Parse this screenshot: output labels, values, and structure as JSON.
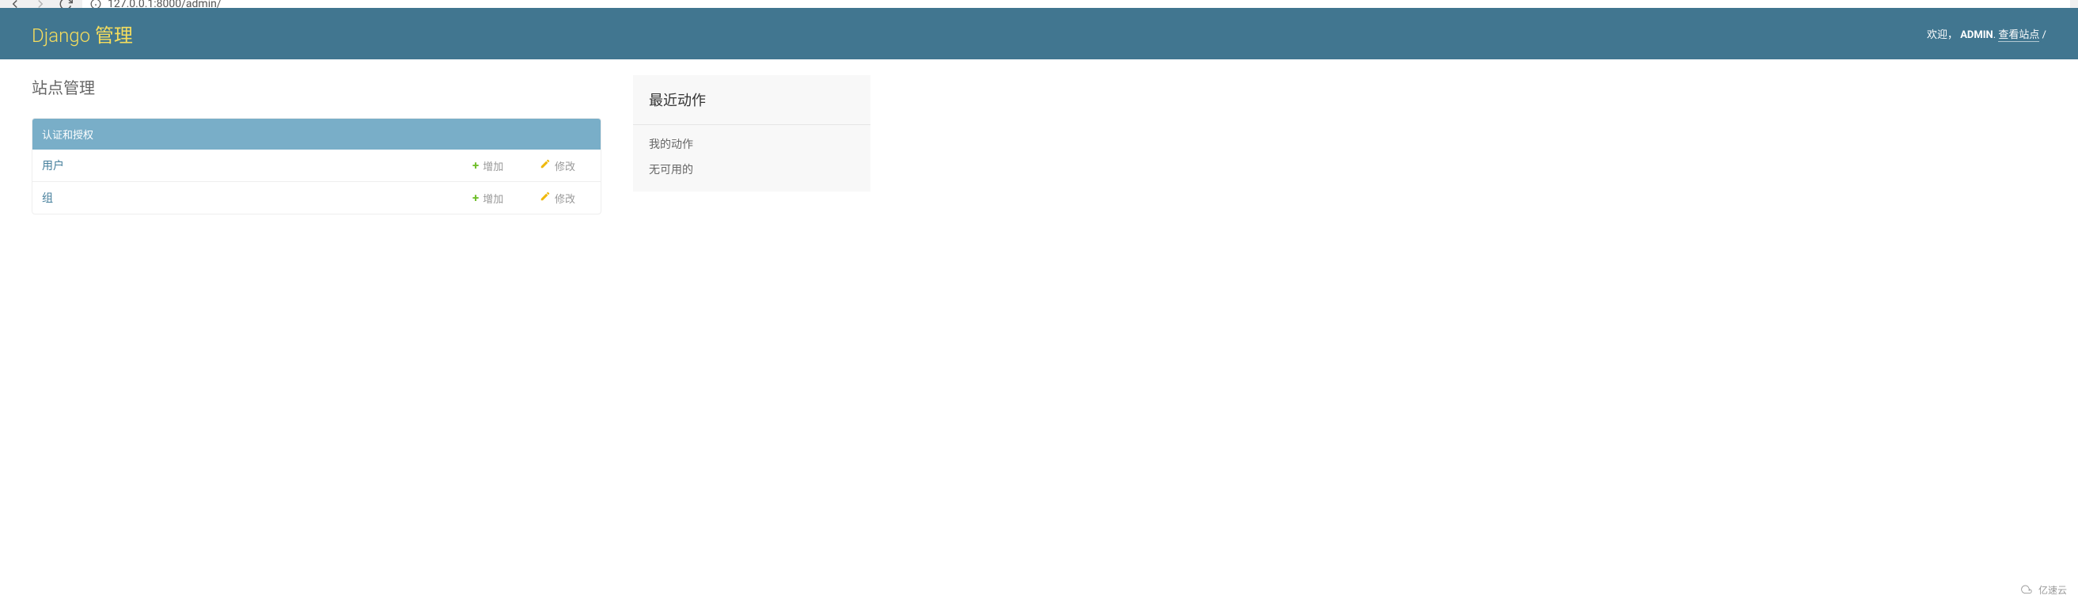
{
  "browser": {
    "url": "127.0.0.1:8000/admin/"
  },
  "header": {
    "branding": "Django 管理",
    "welcome": "欢迎，",
    "username": "ADMIN",
    "view_site": "查看站点",
    "separator": " / "
  },
  "page": {
    "title": "站点管理"
  },
  "app": {
    "name": "认证和授权",
    "models": [
      {
        "name": "用户",
        "add_label": "增加",
        "change_label": "修改"
      },
      {
        "name": "组",
        "add_label": "增加",
        "change_label": "修改"
      }
    ]
  },
  "recent_actions": {
    "title": "最近动作",
    "my_actions": "我的动作",
    "none_available": "无可用的"
  },
  "watermark": {
    "text": "亿速云"
  }
}
